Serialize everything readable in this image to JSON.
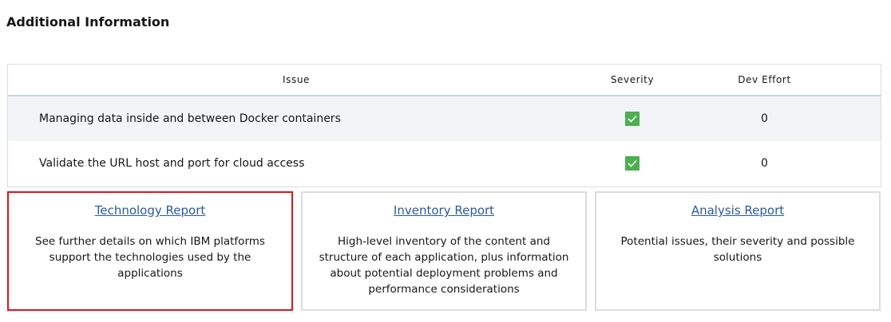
{
  "section_title": "Additional Information",
  "table": {
    "headers": {
      "issue": "Issue",
      "severity": "Severity",
      "effort": "Dev Effort"
    },
    "rows": [
      {
        "issue": "Managing data inside and between Docker containers",
        "severity_icon": "checkmark-icon",
        "effort": "0"
      },
      {
        "issue": "Validate the URL host and port for cloud access",
        "severity_icon": "checkmark-icon",
        "effort": "0"
      }
    ]
  },
  "cards": [
    {
      "link": "Technology Report",
      "description": "See further details on which IBM platforms support the technologies used by the applications"
    },
    {
      "link": "Inventory Report",
      "description": "High-level inventory of the content and structure of each application, plus information about potential deployment problems and performance considerations"
    },
    {
      "link": "Analysis Report",
      "description": "Potential issues, their severity and possible solutions"
    }
  ],
  "colors": {
    "check_green": "#4caf50",
    "link_blue": "#2c5aa0",
    "selected_border": "#e0151b"
  }
}
